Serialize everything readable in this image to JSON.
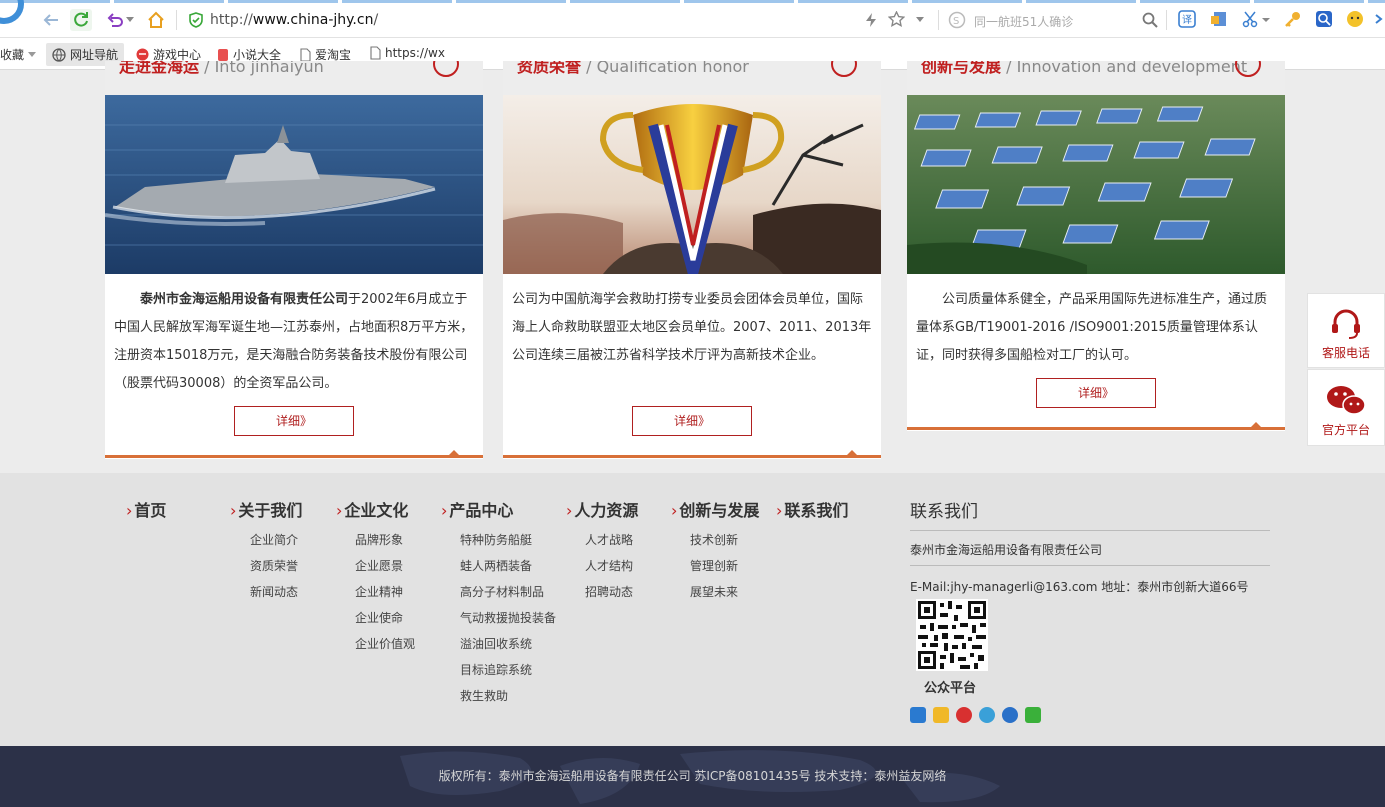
{
  "browser": {
    "url_prefix": "http://",
    "url_domain": "www.china-jhy.cn",
    "url_suffix": "/",
    "search_placeholder": "同一航班51人确诊",
    "bookmarks": [
      {
        "label": "收藏",
        "icon": "star-icon"
      },
      {
        "label": "网址导航",
        "icon": "globe-icon"
      },
      {
        "label": "游戏中心",
        "icon": "game-icon"
      },
      {
        "label": "小说大全",
        "icon": "book-icon"
      },
      {
        "label": "爱淘宝",
        "icon": "page-icon"
      },
      {
        "label": "https://wx",
        "icon": "page-icon"
      }
    ]
  },
  "cards": [
    {
      "title": "走进金海运",
      "subtitle": " / Into jinhaiyun",
      "company": "泰州市金海运船用设备有限责任公司",
      "text": "于2002年6月成立于中国人民解放军海军诞生地—江苏泰州，占地面积8万平方米，注册资本15018万元，是天海融合防务装备技术股份有限公司（股票代码30008）的全资军品公司。",
      "more": "详细》"
    },
    {
      "title": "资质荣誉",
      "subtitle": " / Qualification honor",
      "text": "公司为中国航海学会救助打捞专业委员会团体会员单位，国际海上人命救助联盟亚太地区会员单位。2007、2011、2013年公司连续三届被江苏省科学技术厅评为高新技术企业。",
      "more": "详细》"
    },
    {
      "title": "创新与发展",
      "subtitle": " / Innovation and development",
      "text": "公司质量体系健全，产品采用国际先进标准生产，通过质量体系GB/T19001-2016 /ISO9001:2015质量管理体系认证，同时获得多国船检对工厂的认可。",
      "more": "详细》"
    }
  ],
  "side": {
    "phone": "客服电话",
    "wechat": "官方平台"
  },
  "footer": {
    "arrow": "›",
    "columns": [
      {
        "title": "首页",
        "items": []
      },
      {
        "title": "关于我们",
        "items": [
          "企业简介",
          "资质荣誉",
          "新闻动态"
        ]
      },
      {
        "title": "企业文化",
        "items": [
          "品牌形象",
          "企业愿景",
          "企业精神",
          "企业使命",
          "企业价值观"
        ]
      },
      {
        "title": "产品中心",
        "items": [
          "特种防务船艇",
          "蛙人两栖装备",
          "高分子材料制品",
          "气动救援抛投装备",
          "溢油回收系统",
          "目标追踪系统",
          "救生救助"
        ]
      },
      {
        "title": "人力资源",
        "items": [
          "人才战略",
          "人才结构",
          "招聘动态"
        ]
      },
      {
        "title": "创新与发展",
        "items": [
          "技术创新",
          "管理创新",
          "展望未来"
        ]
      },
      {
        "title": "联系我们",
        "items": []
      }
    ],
    "contact": {
      "title": "联系我们",
      "company": "泰州市金海运船用设备有限责任公司",
      "mail": "E-Mail:jhy-managerli@163.com 地址：泰州市创新大道66号",
      "qr_label": "公众平台"
    },
    "copyright": "版权所有：泰州市金海运船用设备有限责任公司 苏ICP备08101435号 技术支持：泰州益友网络"
  }
}
